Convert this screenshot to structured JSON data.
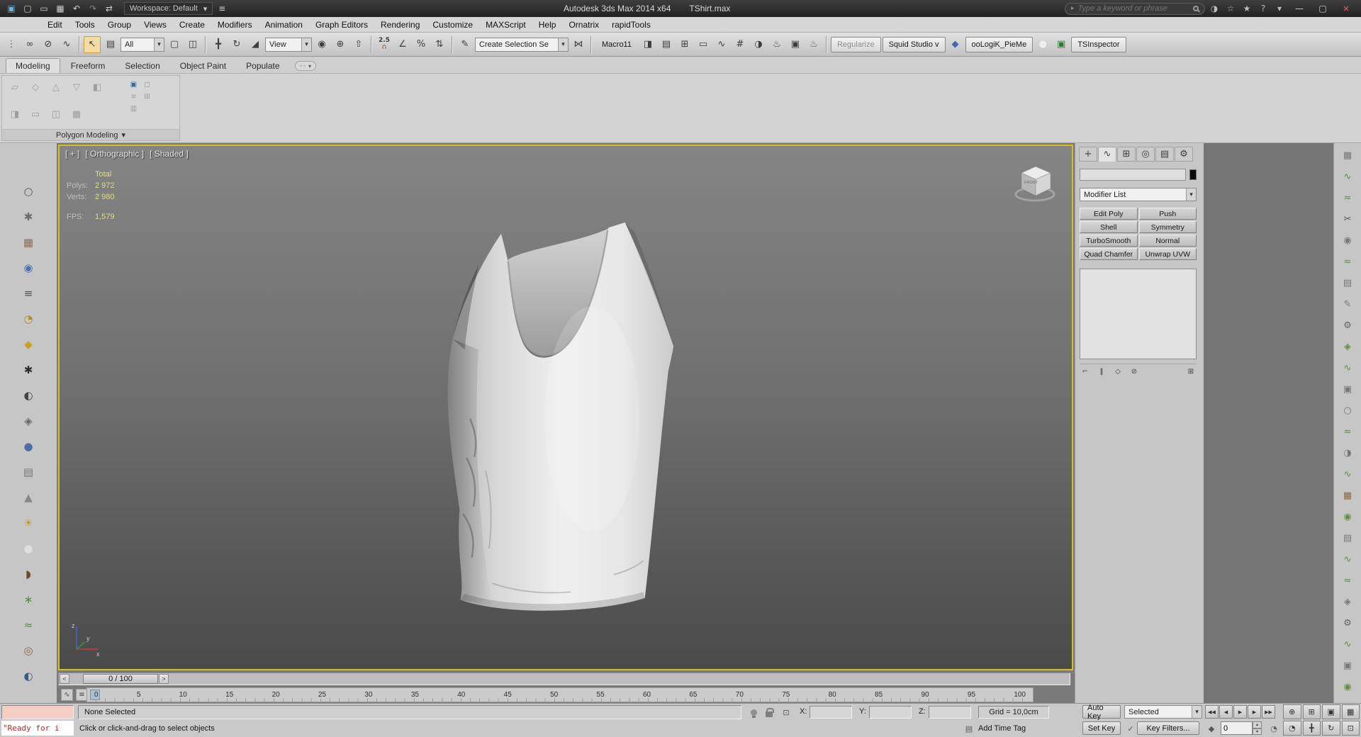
{
  "ui": {
    "dropdown_arrow": "▾",
    "spinner_up": "▴",
    "spinner_down": "▾",
    "search_arrow": "▸",
    "options_dots": "◦◦"
  },
  "titlebar": {
    "workspace": "Workspace: Default",
    "title": "Autodesk 3ds Max  2014 x64",
    "filename": "TShirt.max",
    "search_placeholder": "Type a keyword or phrase",
    "left_icons": [
      {
        "name": "application-menu-icon",
        "glyph": "▣",
        "color": "#6db3d9"
      },
      {
        "name": "new-scene-icon",
        "glyph": "▢",
        "color": "#cfcfcf"
      },
      {
        "name": "open-file-icon",
        "glyph": "▭",
        "color": "#cfcfcf"
      },
      {
        "name": "save-file-icon",
        "glyph": "▦",
        "color": "#cfcfcf"
      },
      {
        "name": "undo-icon",
        "glyph": "↶",
        "color": "#cfcfcf"
      },
      {
        "name": "redo-icon",
        "glyph": "↷",
        "color": "#8a8a8a"
      },
      {
        "name": "project-toggle-icon",
        "glyph": "⇄",
        "color": "#cfcfcf"
      }
    ],
    "right_icons": [
      {
        "name": "sign-in-icon",
        "glyph": "◑",
        "color": "#bdbdbd"
      },
      {
        "name": "communication-center-icon",
        "glyph": "☆",
        "color": "#bdbdbd"
      },
      {
        "name": "favorites-icon",
        "glyph": "★",
        "color": "#bdbdbd"
      },
      {
        "name": "help-icon",
        "glyph": "?",
        "color": "#bdbdbd"
      },
      {
        "name": "help-menu-arrow-icon",
        "glyph": "▾",
        "color": "#bdbdbd"
      }
    ],
    "window_buttons": [
      {
        "name": "minimize-button",
        "glyph": "—",
        "color": "#d0d0d0"
      },
      {
        "name": "maximize-button",
        "glyph": "▢",
        "color": "#d0d0d0"
      },
      {
        "name": "close-button",
        "glyph": "×",
        "color": "#ff5a52"
      }
    ]
  },
  "menus": [
    "Edit",
    "Tools",
    "Group",
    "Views",
    "Create",
    "Modifiers",
    "Animation",
    "Graph Editors",
    "Rendering",
    "Customize",
    "MAXScript",
    "Help",
    "Ornatrix",
    "rapidTools"
  ],
  "toolbar": {
    "selection_filter": "All",
    "ref_coordsys": "View",
    "snap_label": "2.5",
    "snap_glyph": "∩",
    "named_sets_combo": "Create Selection Se",
    "macro_button": "Macro11",
    "regularize_button": "Regularize",
    "squid_button": "Squid Studio v",
    "oologik_button": "ooLogiK_PieMe",
    "tsinspector_button": "TSInspector",
    "g1": [
      {
        "name": "toolbar-handle",
        "glyph": "⋮",
        "color": "#6a6a6a"
      },
      {
        "name": "select-and-link-icon",
        "glyph": "∞"
      },
      {
        "name": "unlink-selection-icon",
        "glyph": "⊘"
      },
      {
        "name": "bind-to-space-warp-icon",
        "glyph": "∿"
      }
    ],
    "g2": [
      {
        "name": "select-object-icon",
        "glyph": "↖",
        "active": true
      },
      {
        "name": "select-by-name-icon",
        "glyph": "▤"
      }
    ],
    "g3": [
      {
        "name": "rectangular-selection-region-icon",
        "glyph": "▢"
      },
      {
        "name": "window-crossing-toggle-icon",
        "glyph": "◫"
      }
    ],
    "g4": [
      {
        "name": "select-and-move-icon",
        "glyph": "╋"
      },
      {
        "name": "select-and-rotate-icon",
        "glyph": "↻"
      },
      {
        "name": "select-and-scale-icon",
        "glyph": "◢"
      }
    ],
    "g5": [
      {
        "name": "use-pivot-point-icon",
        "glyph": "◉"
      },
      {
        "name": "select-and-manipulate-icon",
        "glyph": "⊕"
      },
      {
        "name": "keyboard-shortcut-override-icon",
        "glyph": "⇧"
      }
    ],
    "g6": [
      {
        "name": "angle-snap-icon",
        "glyph": "∠"
      },
      {
        "name": "percent-snap-icon",
        "glyph": "%"
      },
      {
        "name": "spinner-snap-icon",
        "glyph": "⇅"
      }
    ],
    "g7": [
      {
        "name": "edit-named-selection-sets-icon",
        "glyph": "✎"
      }
    ],
    "g8": [
      {
        "name": "mirror-icon",
        "glyph": "⋈"
      }
    ],
    "g9": [
      {
        "name": "align-icon",
        "glyph": "◨"
      },
      {
        "name": "layer-manager-icon",
        "glyph": "▤"
      },
      {
        "name": "scene-explorer-icon",
        "glyph": "⊞"
      },
      {
        "name": "ribbon-toggle-icon",
        "glyph": "▭"
      },
      {
        "name": "curve-editor-icon",
        "glyph": "∿"
      },
      {
        "name": "schematic-view-icon",
        "glyph": "#"
      },
      {
        "name": "material-editor-icon",
        "glyph": "◑"
      },
      {
        "name": "render-setup-icon",
        "glyph": "♨"
      },
      {
        "name": "rendered-frame-window-icon",
        "glyph": "▣"
      },
      {
        "name": "render-production-icon",
        "glyph": "♨",
        "color": "#2e7d32"
      }
    ],
    "g10": [
      {
        "name": "plugin-icon-blue",
        "glyph": "◆",
        "color": "#3a6ab0"
      }
    ],
    "g11": [
      {
        "name": "plugin-icon-white-sphere",
        "glyph": "●",
        "color": "#efefef"
      },
      {
        "name": "plugin-icon-green",
        "glyph": "▣",
        "color": "#2e7d32"
      }
    ]
  },
  "ribbon": {
    "tabs": [
      {
        "label": "Modeling",
        "active": true
      },
      {
        "label": "Freeform"
      },
      {
        "label": "Selection"
      },
      {
        "label": "Object Paint"
      },
      {
        "label": "Populate"
      }
    ],
    "caption": "Polygon Modeling",
    "row1": [
      {
        "name": "edit-poly-mode-icon",
        "glyph": "▱"
      },
      {
        "name": "vertex-mode-icon",
        "glyph": "◇"
      },
      {
        "name": "edge-mode-icon",
        "glyph": "△"
      },
      {
        "name": "border-mode-icon",
        "glyph": "▽"
      },
      {
        "name": "polygon-mode-icon",
        "glyph": "◧"
      }
    ],
    "row2": [
      {
        "name": "element-mode-icon",
        "glyph": "◨"
      },
      {
        "name": "preview-toggle-icon",
        "glyph": "▭"
      },
      {
        "name": "pin-stack-ribbon-icon",
        "glyph": "◫"
      },
      {
        "name": "collapse-stack-icon",
        "glyph": "▦"
      }
    ],
    "side": [
      {
        "name": "use-soft-selection-icon",
        "glyph": "▣",
        "color": "#2e6da4"
      },
      {
        "name": "lock-soft-selection-icon",
        "glyph": "◻"
      },
      {
        "name": "edit-from-view-icon",
        "glyph": "≡"
      },
      {
        "name": "paint-soft-selection-icon",
        "glyph": "⊞"
      },
      {
        "name": "falloff-icon",
        "glyph": "▥"
      }
    ]
  },
  "left_toolbar": [
    {
      "name": "sphere-tool-icon",
      "glyph": "○",
      "color": "#5a5a5a"
    },
    {
      "name": "burst-tool-icon",
      "glyph": "✱",
      "color": "#6a6a6a"
    },
    {
      "name": "box-tool-icon",
      "glyph": "▦",
      "color": "#8a7050"
    },
    {
      "name": "blue-sphere-tool-icon",
      "glyph": "◉",
      "color": "#4a72a8"
    },
    {
      "name": "list-tool-icon",
      "glyph": "≡",
      "color": "#555555"
    },
    {
      "name": "clock-tool-icon",
      "glyph": "◔",
      "color": "#b08a30"
    },
    {
      "name": "pin-tool-icon",
      "glyph": "◆",
      "color": "#c8a020"
    },
    {
      "name": "spider-tool-icon",
      "glyph": "✱",
      "color": "#2f2f2f"
    },
    {
      "name": "figure-tool-icon",
      "glyph": "◐",
      "color": "#444444"
    },
    {
      "name": "gem-tool-icon",
      "glyph": "◈",
      "color": "#666666"
    },
    {
      "name": "ball-tool-icon",
      "glyph": "●",
      "color": "#4a6fa0"
    },
    {
      "name": "panel-tool-icon",
      "glyph": "▤",
      "color": "#777777"
    },
    {
      "name": "cone-tool-icon",
      "glyph": "▲",
      "color": "#888888"
    },
    {
      "name": "sun-tool-icon",
      "glyph": "☀",
      "color": "#c89820"
    },
    {
      "name": "white-sphere-tool-icon",
      "glyph": "●",
      "color": "#e0e0e0"
    },
    {
      "name": "pot-tool-icon",
      "glyph": "◗",
      "color": "#6f4a28"
    },
    {
      "name": "plant-tool-icon",
      "glyph": "∗",
      "color": "#5a8a3a"
    },
    {
      "name": "grass-tool-icon",
      "glyph": "≈",
      "color": "#5a8a3a"
    },
    {
      "name": "ring-tool-icon",
      "glyph": "◎",
      "color": "#8a6a4a"
    },
    {
      "name": "globe-tool-icon",
      "glyph": "◐",
      "color": "#3a5a8a"
    }
  ],
  "right_toolbar": [
    {
      "glyph": "▦",
      "color": "#777777"
    },
    {
      "glyph": "∿",
      "color": "#5f8f3f"
    },
    {
      "glyph": "≈",
      "color": "#5f8f3f"
    },
    {
      "glyph": "✂",
      "color": "#555566"
    },
    {
      "glyph": "◉",
      "color": "#777777"
    },
    {
      "glyph": "≈",
      "color": "#5f8f3f"
    },
    {
      "glyph": "▤",
      "color": "#777777"
    },
    {
      "glyph": "✎",
      "color": "#777777"
    },
    {
      "glyph": "⚙",
      "color": "#666666"
    },
    {
      "glyph": "◈",
      "color": "#5f8f3f"
    },
    {
      "glyph": "∿",
      "color": "#5f8f3f"
    },
    {
      "glyph": "▣",
      "color": "#777777"
    },
    {
      "glyph": "○",
      "color": "#777777"
    },
    {
      "glyph": "≈",
      "color": "#5f8f3f"
    },
    {
      "glyph": "◑",
      "color": "#777777"
    },
    {
      "glyph": "∿",
      "color": "#5f8f3f"
    },
    {
      "glyph": "▦",
      "color": "#8a6a4a"
    },
    {
      "glyph": "◉",
      "color": "#5f8f3f"
    },
    {
      "glyph": "▤",
      "color": "#777777"
    },
    {
      "glyph": "∿",
      "color": "#5f8f3f"
    },
    {
      "glyph": "≈",
      "color": "#5f8f3f"
    },
    {
      "glyph": "◈",
      "color": "#777777"
    },
    {
      "glyph": "⚙",
      "color": "#666666"
    },
    {
      "glyph": "∿",
      "color": "#5f8f3f"
    },
    {
      "glyph": "▣",
      "color": "#777777"
    },
    {
      "glyph": "◉",
      "color": "#5f8f3f"
    }
  ],
  "viewport": {
    "label_segments": [
      "[ + ]",
      "[ Orthographic ]",
      "[ Shaded ]"
    ],
    "stats": {
      "header": "Total",
      "rows": [
        {
          "label": "Polys:",
          "value": "2 972"
        },
        {
          "label": "Verts:",
          "value": "2 980"
        }
      ],
      "fps_label": "FPS:",
      "fps_value": "1,579"
    },
    "viewcube_label": "FRONT",
    "axis": {
      "x": "x",
      "y": "y",
      "z": "z"
    }
  },
  "timeline": {
    "prev": "<",
    "handle": "0 / 100",
    "next": ">"
  },
  "trackbar": {
    "ticks": [
      "0",
      "5",
      "10",
      "15",
      "20",
      "25",
      "30",
      "35",
      "40",
      "45",
      "50",
      "55",
      "60",
      "65",
      "70",
      "75",
      "80",
      "85",
      "90",
      "95",
      "100"
    ],
    "left_icons": [
      {
        "name": "open-mini-curve-editor-icon",
        "glyph": "∿"
      },
      {
        "name": "track-options-icon",
        "glyph": "≡"
      }
    ]
  },
  "command_panel": {
    "tabs": [
      {
        "name": "create-tab",
        "glyph": "+"
      },
      {
        "name": "modify-tab",
        "glyph": "∿",
        "active": true
      },
      {
        "name": "hierarchy-tab",
        "glyph": "⊞"
      },
      {
        "name": "motion-tab",
        "glyph": "◎"
      },
      {
        "name": "display-tab",
        "glyph": "▤"
      },
      {
        "name": "utilities-tab",
        "glyph": "⚙"
      }
    ],
    "object_name_value": "",
    "swatch_style": "background:#0c0c0c",
    "modifier_list_label": "Modifier List",
    "modifier_buttons": [
      "Edit Poly",
      "Push",
      "Shell",
      "Symmetry",
      "TurboSmooth",
      "Normal",
      "Quad Chamfer",
      "Unwrap UVW"
    ],
    "stack_tools": [
      {
        "name": "pin-stack-icon",
        "glyph": "⌐"
      },
      {
        "name": "show-end-result-icon",
        "glyph": "‖"
      },
      {
        "name": "make-unique-icon",
        "glyph": "◇"
      },
      {
        "name": "remove-modifier-icon",
        "glyph": "⊘"
      },
      {
        "name": "configure-modifier-sets-icon",
        "glyph": "⊞"
      }
    ]
  },
  "statusbar": {
    "listener_text": "\"Ready for i",
    "selection": "None Selected",
    "prompt": "Click or click-and-drag to select objects",
    "coord_icon": "⊡",
    "x_label": "X:",
    "x_value": "",
    "y_label": "Y:",
    "y_value": "",
    "z_label": "Z:",
    "z_value": "",
    "grid": "Grid = 10,0cm",
    "add_tag_icon": "▤",
    "add_time_tag": "Add Time Tag",
    "auto_key": "Auto Key",
    "selected_combo": "Selected",
    "set_key": "Set Key",
    "key_check": "✓",
    "key_filters": "Key Filters...",
    "key_mode_glyph": "◆",
    "time_config_glyph": "◔",
    "time_value": "0",
    "playback": [
      {
        "name": "go-to-start-button",
        "glyph": "◀◀"
      },
      {
        "name": "previous-frame-button",
        "glyph": "◀"
      },
      {
        "name": "play-animation-button",
        "glyph": "▶"
      },
      {
        "name": "next-frame-button",
        "glyph": "▶"
      },
      {
        "name": "go-to-end-button",
        "glyph": "▶▶"
      }
    ],
    "navigation": [
      {
        "name": "zoom-icon",
        "glyph": "⊕"
      },
      {
        "name": "zoom-all-icon",
        "glyph": "⊞"
      },
      {
        "name": "zoom-extents-icon",
        "glyph": "▣"
      },
      {
        "name": "zoom-extents-all-icon",
        "glyph": "▦"
      },
      {
        "name": "field-of-view-icon",
        "glyph": "◔"
      },
      {
        "name": "pan-view-icon",
        "glyph": "╋"
      },
      {
        "name": "orbit-viewport-icon",
        "glyph": "↻"
      },
      {
        "name": "maximize-viewport-toggle-icon",
        "glyph": "⊡"
      }
    ]
  }
}
